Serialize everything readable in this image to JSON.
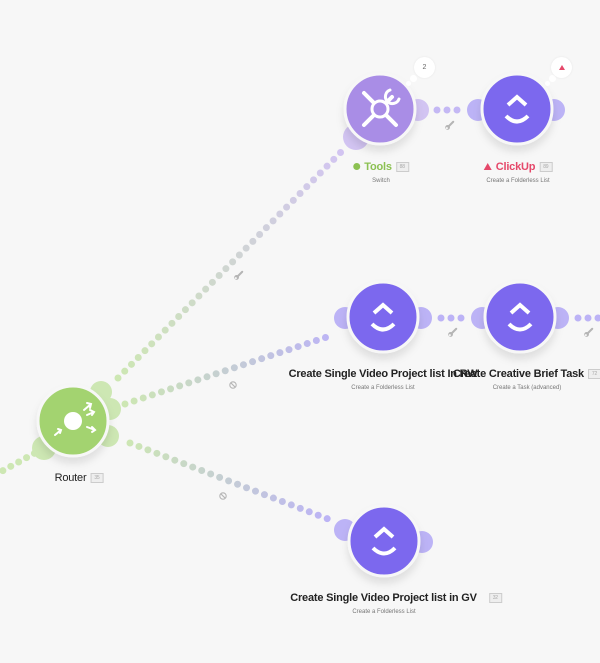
{
  "colors": {
    "background": "#f7f7f7",
    "router": "#a3d36f",
    "router_light": "#cde7b3",
    "tools": "#a98de6",
    "tools_light": "#d2c4f2",
    "clickup": "#7b68ee",
    "clickup_light": "#bcb3f6",
    "ok_green": "#8cc152",
    "warning_red": "#e5486a"
  },
  "modules": [
    {
      "id": "router",
      "name": "Router",
      "subtitle": "",
      "badge": "35",
      "icon": "router-icon"
    },
    {
      "id": "tools",
      "name": "Tools",
      "subtitle": "Switch",
      "badge": "88",
      "icon": "tools-icon",
      "status": "ok",
      "bubble": "2"
    },
    {
      "id": "clickup-folderless",
      "name": "ClickUp",
      "subtitle": "Create a Folderless List",
      "badge": "89",
      "icon": "clickup-icon",
      "status": "warning",
      "bubble": "warning"
    },
    {
      "id": "rw-list",
      "name": "Create Single Video Project list In RW",
      "subtitle": "Create a Folderless List",
      "badge": "",
      "icon": "clickup-icon"
    },
    {
      "id": "creative-brief",
      "name": "Create Creative Brief Task",
      "subtitle": "Create a Task (advanced)",
      "badge": "72",
      "icon": "clickup-icon"
    },
    {
      "id": "gv-list",
      "name": "Create Single Video Project list in GV",
      "subtitle": "Create a Folderless List",
      "badge": "32",
      "icon": "clickup-icon"
    }
  ],
  "connections": [
    {
      "from": "incoming",
      "to": "router",
      "filter": "none"
    },
    {
      "from": "router",
      "to": "tools",
      "filter": "wrench-icon"
    },
    {
      "from": "router",
      "to": "rw-list",
      "filter": "no-filter-icon"
    },
    {
      "from": "router",
      "to": "gv-list",
      "filter": "no-filter-icon"
    },
    {
      "from": "tools",
      "to": "clickup-folderless",
      "filter": "wrench-icon"
    },
    {
      "from": "rw-list",
      "to": "creative-brief",
      "filter": "wrench-icon"
    },
    {
      "from": "creative-brief",
      "to": "outgoing",
      "filter": "wrench-icon"
    }
  ]
}
